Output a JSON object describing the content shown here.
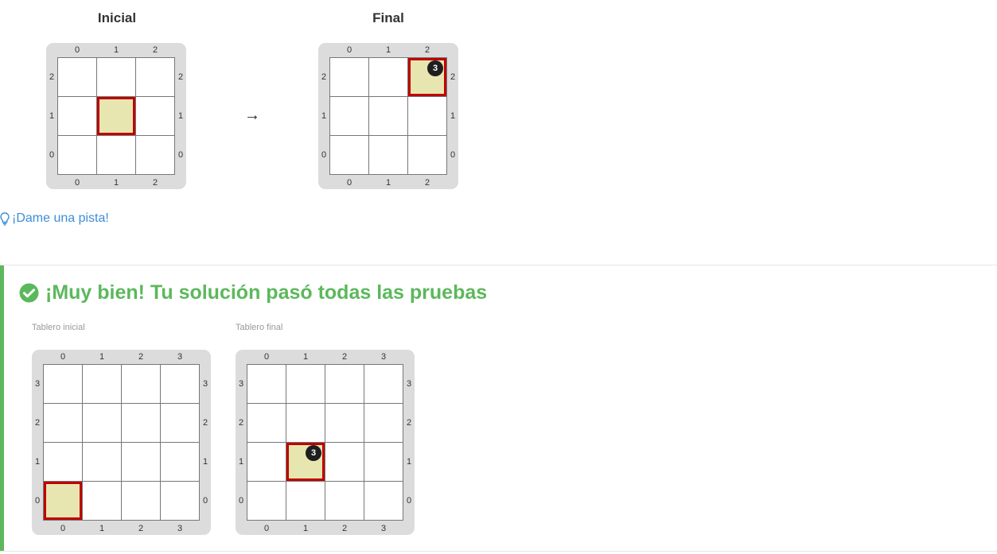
{
  "exercise": {
    "initial_title": "Inicial",
    "final_title": "Final",
    "arrow": "→",
    "initial_board": {
      "cols": 3,
      "rows": 3,
      "head": [
        1,
        1
      ],
      "ball": null,
      "ball_count": ""
    },
    "final_board": {
      "cols": 3,
      "rows": 3,
      "head": [
        2,
        2
      ],
      "ball": [
        2,
        2
      ],
      "ball_count": "3"
    }
  },
  "hint": {
    "label": "¡Dame una pista!",
    "icon": "lightbulb-icon"
  },
  "result": {
    "title": "¡Muy bien! Tu solución pasó todas las pruebas",
    "icon": "check-circle-icon",
    "color": "#5cb85c",
    "initial_caption": "Tablero inicial",
    "final_caption": "Tablero final",
    "initial_board": {
      "cols": 4,
      "rows": 4,
      "head": [
        0,
        0
      ],
      "ball": null,
      "ball_count": ""
    },
    "final_board": {
      "cols": 4,
      "rows": 4,
      "head": [
        1,
        1
      ],
      "ball": [
        1,
        1
      ],
      "ball_count": "3"
    }
  },
  "colors": {
    "head_fill": "#e8e6b0",
    "head_border": "#c00000",
    "board_bg": "#dcdcdc",
    "link": "#3b8ed8"
  }
}
